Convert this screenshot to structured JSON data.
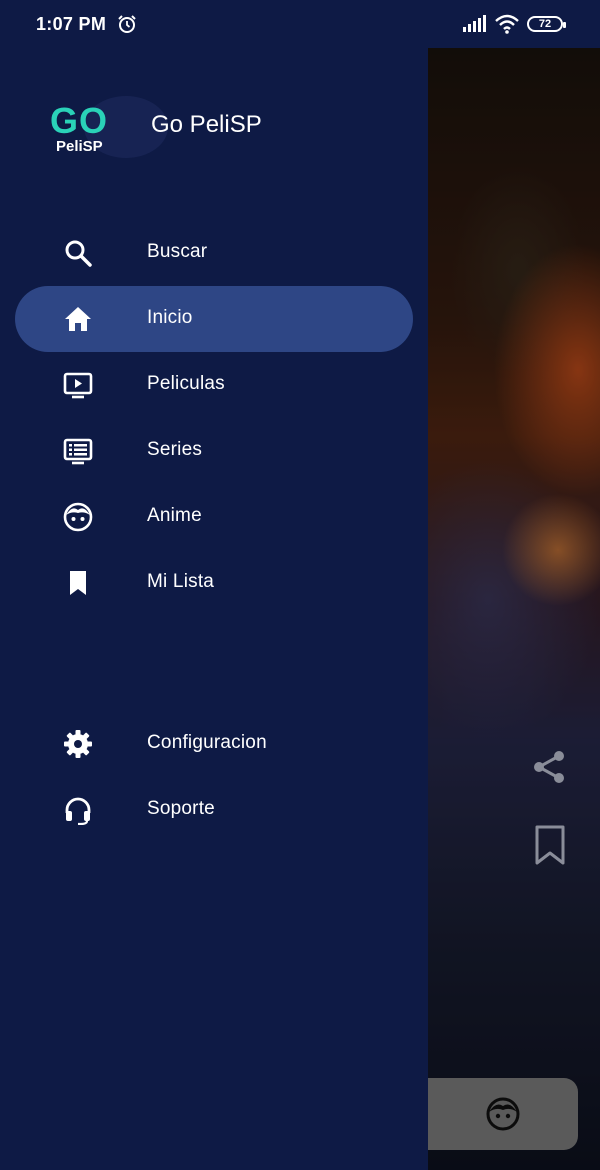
{
  "status_bar": {
    "time": "1:07 PM",
    "battery": "72",
    "icons": [
      "alarm-icon",
      "signal-icon",
      "wifi-icon",
      "battery-icon"
    ]
  },
  "drawer": {
    "logo": {
      "main": "GO",
      "sub": "PeliSP"
    },
    "app_title": "Go PeliSP",
    "items": [
      {
        "label": "Buscar",
        "icon": "search-icon"
      },
      {
        "label": "Inicio",
        "icon": "home-icon",
        "active": true
      },
      {
        "label": "Peliculas",
        "icon": "movie-tv-icon"
      },
      {
        "label": "Series",
        "icon": "series-list-icon"
      },
      {
        "label": "Anime",
        "icon": "anime-face-icon"
      },
      {
        "label": "Mi Lista",
        "icon": "bookmark-icon"
      }
    ],
    "secondary_items": [
      {
        "label": "Configuracion",
        "icon": "gear-icon"
      },
      {
        "label": "Soporte",
        "icon": "headset-icon"
      }
    ]
  },
  "background": {
    "side_actions": [
      "share-icon",
      "bookmark-outline-icon"
    ],
    "fab_icon": "anime-face-icon"
  },
  "colors": {
    "drawer_bg": "#0e1a45",
    "active_item_bg": "#2e4685",
    "logo_accent": "#2ad2b8",
    "text": "#ffffff"
  }
}
